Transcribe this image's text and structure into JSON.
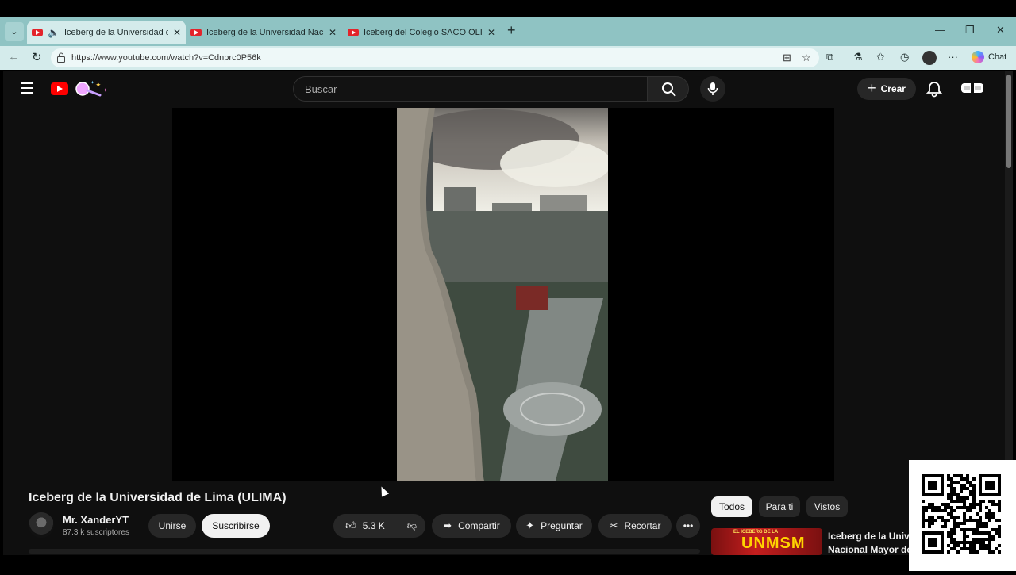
{
  "browser": {
    "tabs": [
      {
        "title": "Iceberg de la Universidad de Lima (ULIMA)",
        "active": true,
        "audio": true
      },
      {
        "title": "Iceberg de la Universidad Nacional Mayor de San Marcos",
        "active": false
      },
      {
        "title": "Iceberg del Colegio SACO OLIVEROS",
        "active": false
      }
    ],
    "url": "https://www.youtube.com/watch?v=Cdnprc0P56k",
    "chat_label": "Chat"
  },
  "youtube": {
    "search_placeholder": "Buscar",
    "create_label": "Crear",
    "video": {
      "title": "Iceberg de la Universidad de Lima (ULIMA)",
      "channel": "Mr. XanderYT",
      "subscribers": "87.3 k suscriptores",
      "join_label": "Unirse",
      "subscribe_label": "Suscribirse",
      "likes": "5.3 K",
      "share_label": "Compartir",
      "ask_label": "Preguntar",
      "clip_label": "Recortar"
    },
    "chips": [
      "Todos",
      "Para ti",
      "Vistos"
    ],
    "recommended": {
      "thumb_top": "EL ICEBERG DE LA",
      "thumb_main": "UNMSM",
      "title_line1": "Iceberg de la Universidad",
      "title_line2": "Nacional Mayor de San Marcos"
    }
  },
  "colors": {
    "tab_strip": "#8fc3c3",
    "toolbar": "#d4ebeb",
    "yt_background": "#0f0f0f",
    "yt_red": "#ff0000"
  }
}
